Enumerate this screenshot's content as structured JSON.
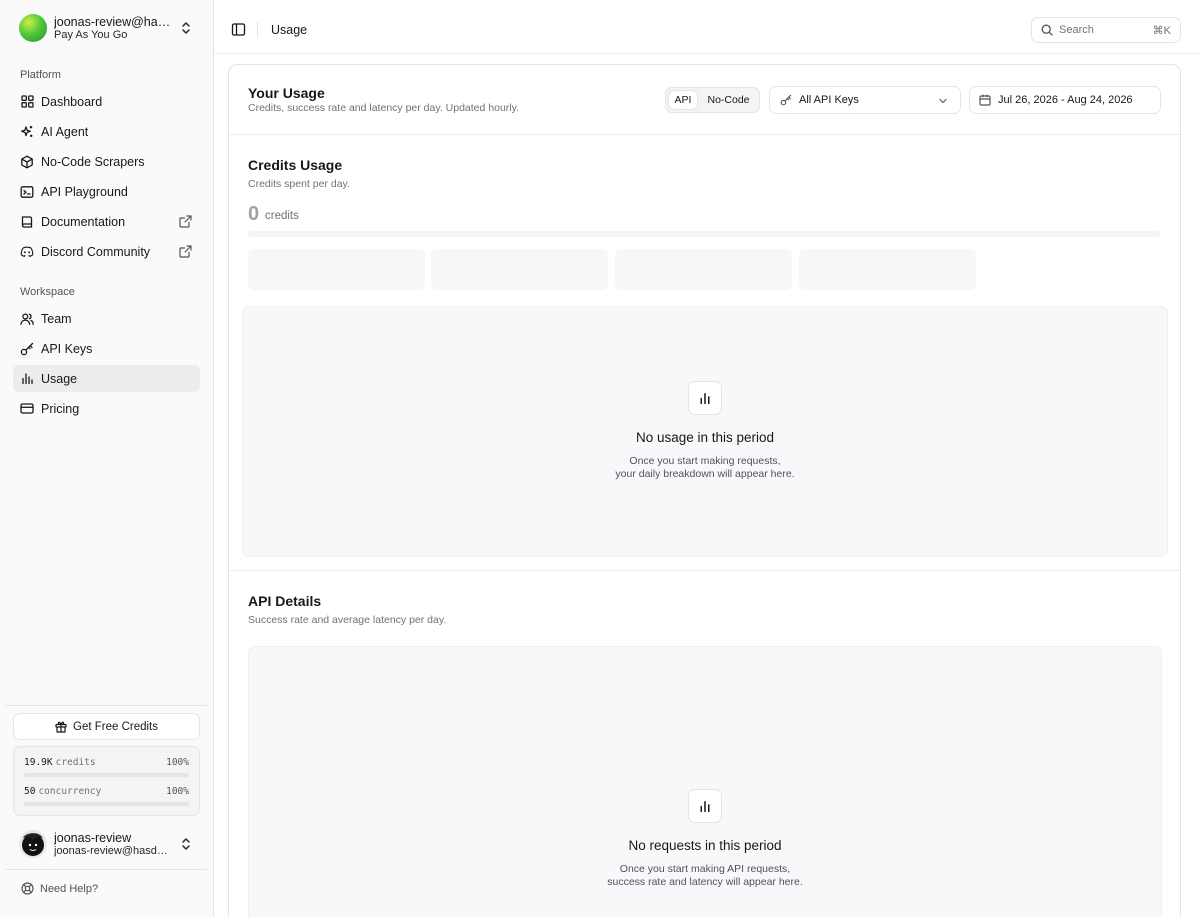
{
  "sidebar": {
    "org": {
      "name": "joonas-review@hasdata.com",
      "plan": "Pay As You Go"
    },
    "platform_label": "Platform",
    "platform_items": [
      {
        "label": "Dashboard",
        "icon": "grid-icon"
      },
      {
        "label": "AI Agent",
        "icon": "sparkles-icon"
      },
      {
        "label": "No-Code Scrapers",
        "icon": "box-icon"
      },
      {
        "label": "API Playground",
        "icon": "terminal-icon"
      },
      {
        "label": "Documentation",
        "icon": "book-icon",
        "external": true
      },
      {
        "label": "Discord Community",
        "icon": "discord-icon",
        "external": true
      }
    ],
    "workspace_label": "Workspace",
    "workspace_items": [
      {
        "label": "Team",
        "icon": "users-icon"
      },
      {
        "label": "API Keys",
        "icon": "key-icon"
      },
      {
        "label": "Usage",
        "icon": "bar-chart-icon",
        "active": true
      },
      {
        "label": "Pricing",
        "icon": "credit-card-icon"
      }
    ],
    "free_credits_label": "Get Free Credits",
    "quota": {
      "credits_value": "19.9K",
      "credits_unit": "credits",
      "credits_pct": "100%",
      "credits_fraction": 0.0,
      "concurrency_value": "50",
      "concurrency_unit": "concurrency",
      "concurrency_pct": "100%",
      "concurrency_fraction": 0.0
    },
    "user": {
      "name": "joonas-review",
      "email": "joonas-review@hasdata.com"
    },
    "help_label": "Need Help?"
  },
  "topbar": {
    "breadcrumb": "Usage",
    "search_placeholder": "Search",
    "search_shortcut": "⌘K"
  },
  "usage": {
    "title": "Your Usage",
    "subtitle": "Credits, success rate and latency per day. Updated hourly.",
    "segments": [
      "API",
      "No-Code"
    ],
    "selected_segment": "API",
    "api_key_filter": "All API Keys",
    "date_range": "Jul 26, 2026 - Aug 24, 2026"
  },
  "credits_usage": {
    "title": "Credits Usage",
    "subtitle": "Credits spent per day.",
    "total_value": "0",
    "total_unit": "credits",
    "empty_title": "No usage in this period",
    "empty_line1": "Once you start making requests,",
    "empty_line2": "your daily breakdown will appear here."
  },
  "api_details": {
    "title": "API Details",
    "subtitle": "Success rate and average latency per day.",
    "empty_title": "No requests in this period",
    "empty_line1": "Once you start making API requests,",
    "empty_line2": "success rate and latency will appear here."
  },
  "colors": {
    "accent_bg": "#ececef",
    "border": "#e4e4e7",
    "muted_text": "#71717a"
  }
}
